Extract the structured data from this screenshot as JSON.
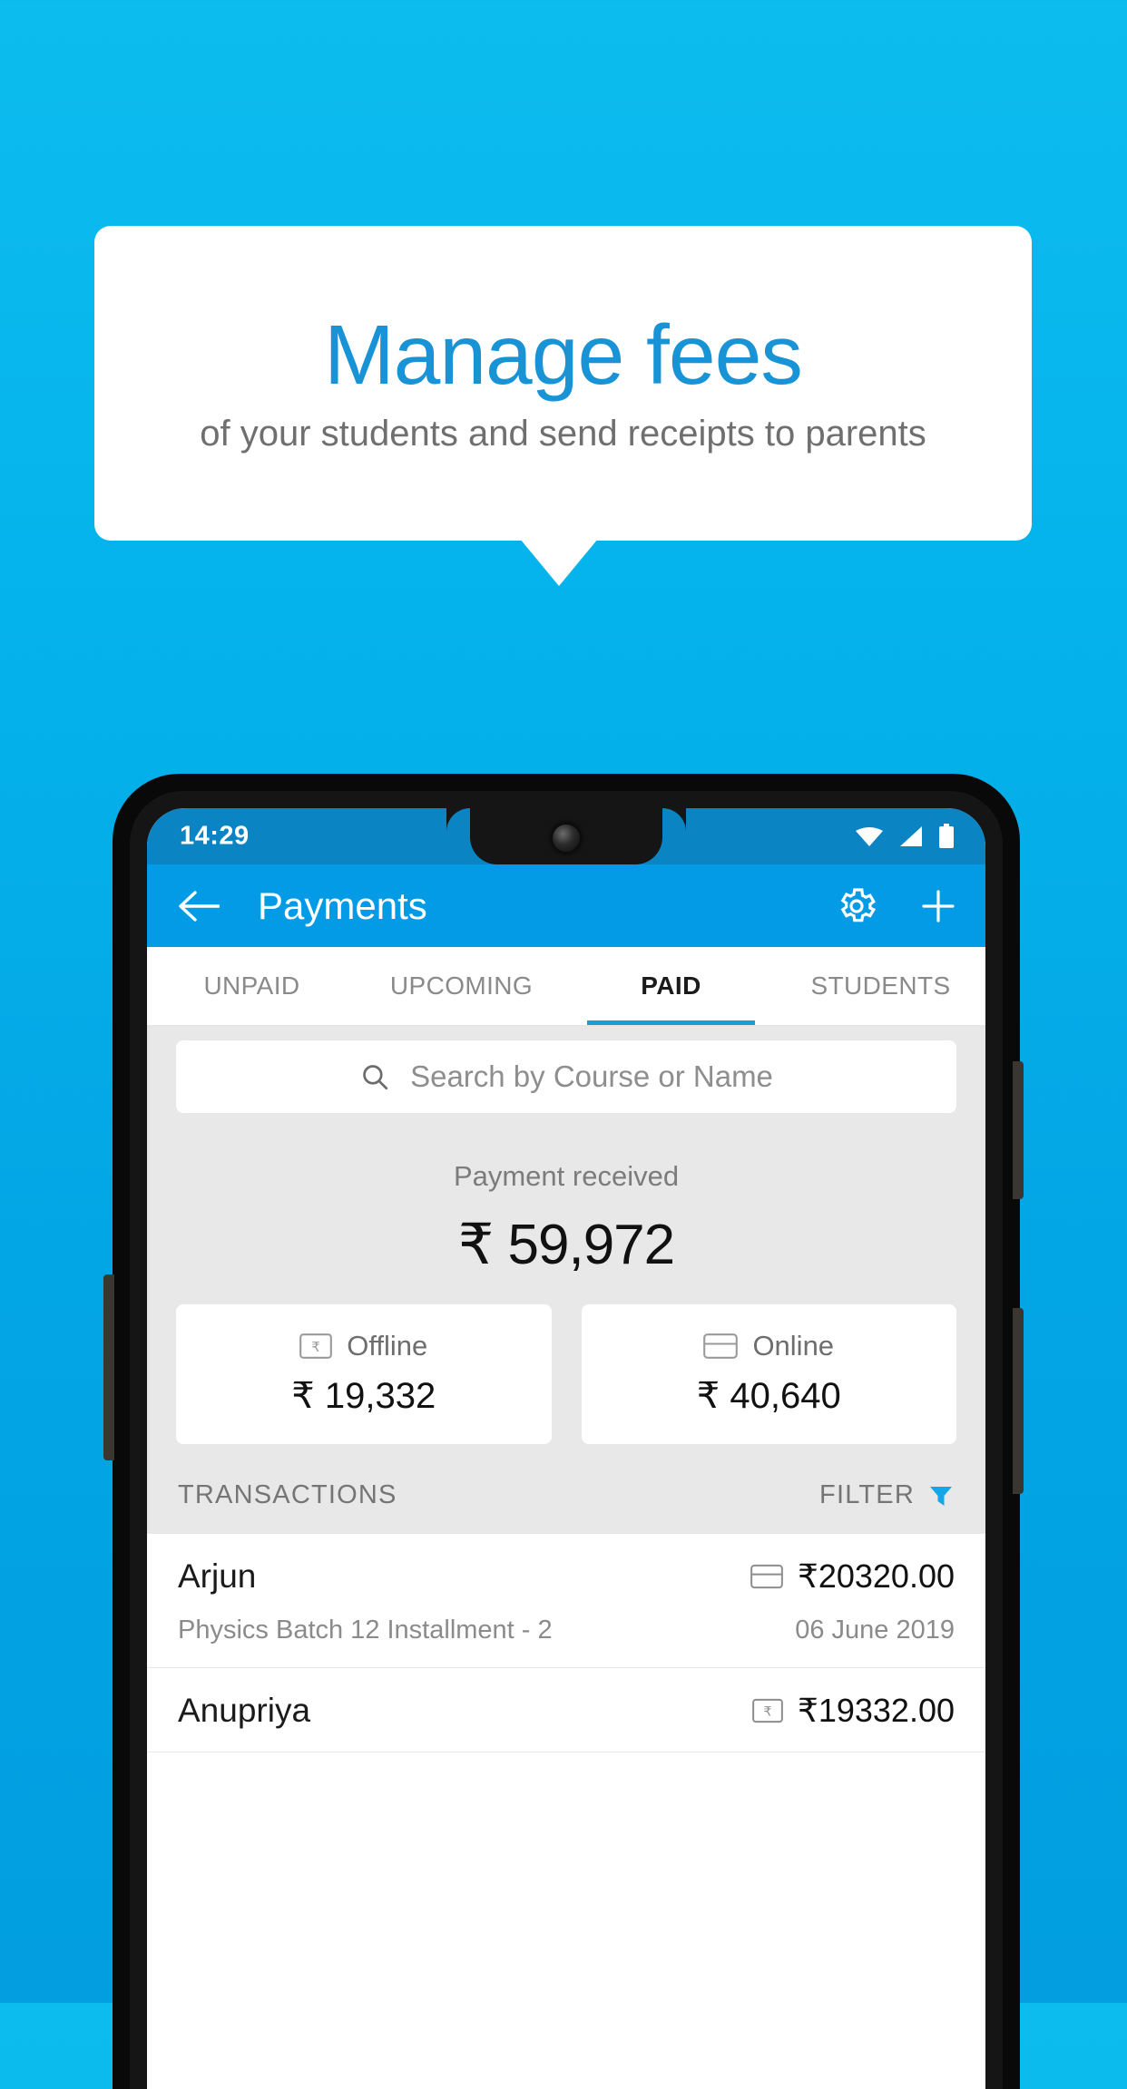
{
  "promo": {
    "title": "Manage fees",
    "subtitle": "of your students and send receipts to parents",
    "title_color": "#1793D6",
    "background_color": "#03A6E4"
  },
  "phone": {
    "status_bar": {
      "time": "14:29",
      "icons": [
        "wifi-icon",
        "signal-icon",
        "battery-icon"
      ],
      "background_color": "#0A84C2"
    },
    "app_bar": {
      "back_label": "back-arrow-icon",
      "title": "Payments",
      "settings_label": "gear-icon",
      "add_label": "plus-icon",
      "background_color": "#039BE5"
    },
    "tabs": [
      {
        "label": "UNPAID",
        "active": false
      },
      {
        "label": "UPCOMING",
        "active": false
      },
      {
        "label": "PAID",
        "active": true
      },
      {
        "label": "STUDENTS",
        "active": false
      }
    ],
    "search": {
      "placeholder": "Search by Course or Name",
      "value": ""
    },
    "summary": {
      "label": "Payment received",
      "amount": "₹ 59,972",
      "cards": [
        {
          "label": "Offline",
          "amount": "₹ 19,332",
          "icon": "cash-note-icon"
        },
        {
          "label": "Online",
          "amount": "₹ 40,640",
          "icon": "credit-card-icon"
        }
      ]
    },
    "transactions_header": {
      "title": "TRANSACTIONS",
      "filter_label": "FILTER",
      "filter_icon_color": "#15A6E8"
    },
    "transactions": [
      {
        "name": "Arjun",
        "amount": "₹20320.00",
        "method_icon": "credit-card-icon",
        "description": "Physics Batch 12 Installment - 2",
        "date": "06 June 2019"
      },
      {
        "name": "Anupriya",
        "amount": "₹19332.00",
        "method_icon": "cash-note-icon",
        "description": "",
        "date": ""
      }
    ]
  }
}
